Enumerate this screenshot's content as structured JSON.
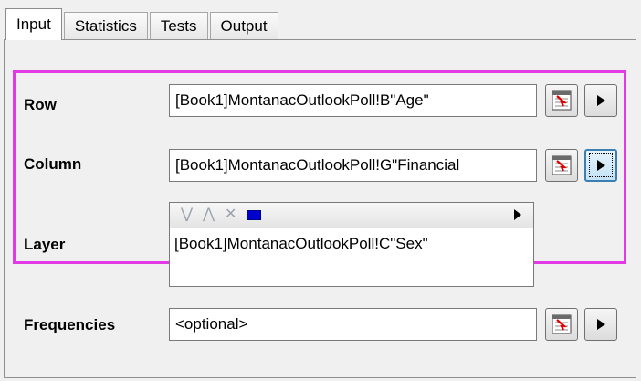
{
  "tabs": [
    {
      "label": "Input"
    },
    {
      "label": "Statistics"
    },
    {
      "label": "Tests"
    },
    {
      "label": "Output"
    }
  ],
  "active_tab": "Input",
  "highlight_color": "#e23ae4",
  "fields": {
    "row": {
      "label": "Row",
      "value": "[Book1]MontanacOutlookPoll!B\"Age\""
    },
    "column": {
      "label": "Column",
      "value": "[Book1]MontanacOutlookPoll!G\"Financial"
    },
    "layer": {
      "label": "Layer",
      "items": [
        "[Book1]MontanacOutlookPoll!C\"Sex\""
      ]
    },
    "frequencies": {
      "label": "Frequencies",
      "value": "<optional>"
    }
  },
  "layer_toolbar_icons": [
    "move-down-icon",
    "move-up-icon",
    "delete-icon",
    "color-swatch-icon",
    "expand-arrow-icon"
  ],
  "button_icons": [
    "select-range-icon",
    "play-arrow-icon"
  ]
}
